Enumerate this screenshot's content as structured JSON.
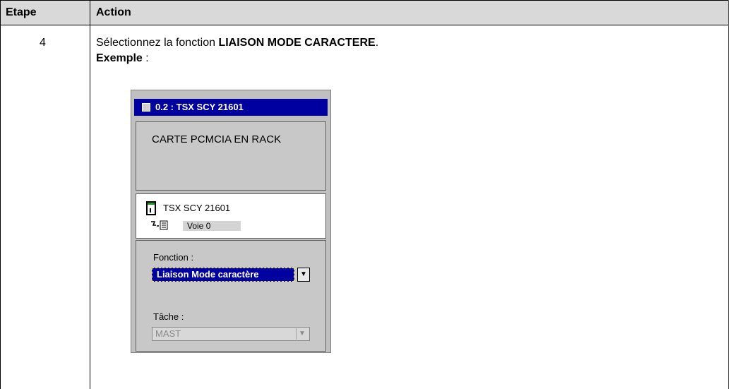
{
  "table": {
    "header": {
      "col1": "Etape",
      "col2": "Action"
    },
    "row": {
      "step": "4",
      "instruction_prefix": "Sélectionnez la fonction ",
      "instruction_bold": "LIAISON MODE CARACTERE",
      "instruction_suffix": ".",
      "example_label": "Exemple",
      "example_suffix": " :"
    }
  },
  "dialog": {
    "title": "0.2 : TSX SCY 21601",
    "card_label": "CARTE PCMCIA EN RACK",
    "module_name": "TSX SCY 21601",
    "channel": "Voie 0",
    "fonction_label": "Fonction :",
    "fonction_value": "Liaison Mode caractère",
    "tache_label": "Tâche :",
    "tache_value": "MAST",
    "icons": [
      "window-icon",
      "rack-module-icon",
      "channel-icon",
      "dropdown-arrow-icon"
    ]
  }
}
